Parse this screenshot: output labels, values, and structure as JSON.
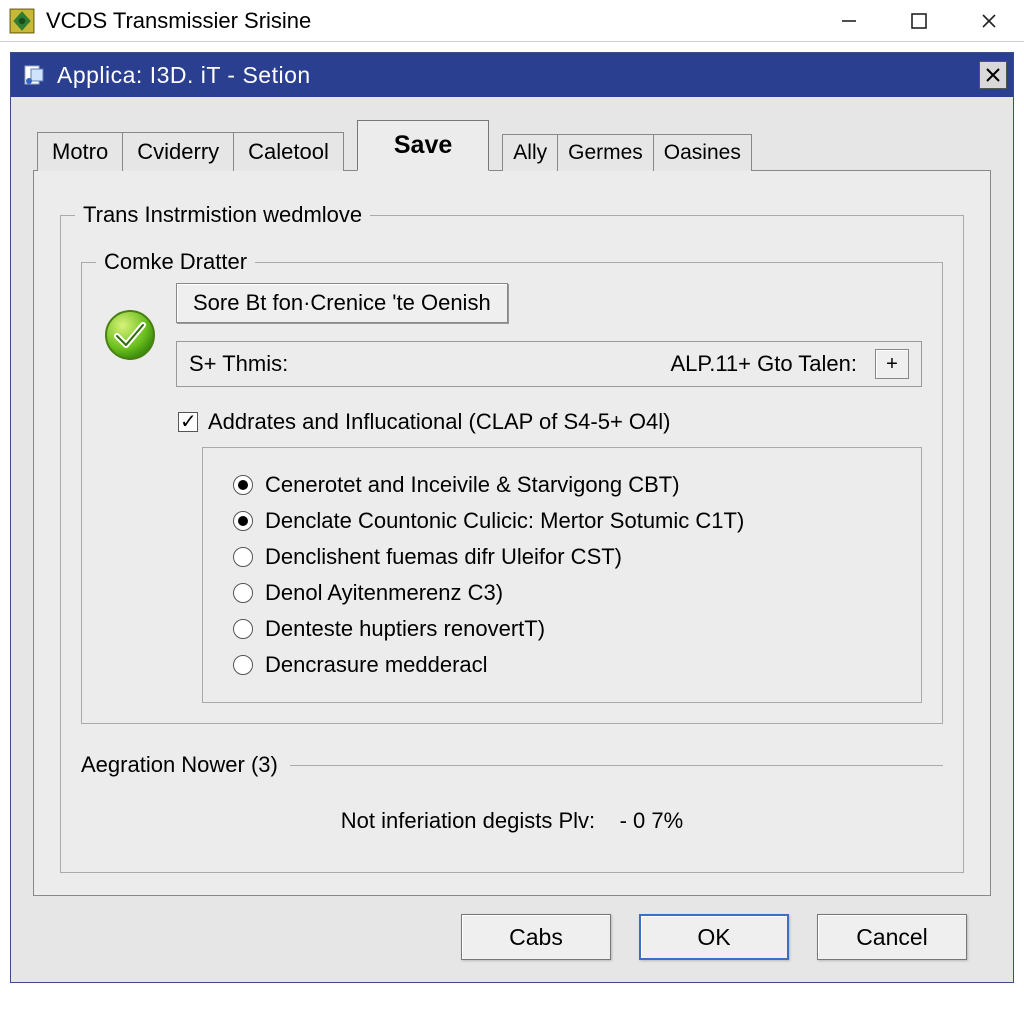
{
  "outer_window": {
    "title": "VCDS Transmissier Srisine"
  },
  "inner_window": {
    "title": "Applica: I3D. iT - Setion"
  },
  "tabs": [
    {
      "label": "Motro",
      "active": false
    },
    {
      "label": "Cviderry",
      "active": false
    },
    {
      "label": "Caletool",
      "active": false
    },
    {
      "label": "Save",
      "active": true
    },
    {
      "label": "Ally",
      "active": false
    },
    {
      "label": "Germes",
      "active": false
    },
    {
      "label": "Oasines",
      "active": false
    }
  ],
  "panel": {
    "heading": "Trans Instrmistion wedmlove",
    "group1": {
      "legend": "Comke Dratter",
      "button_label": "Sore Bt fon·Crenice 'te Oenish",
      "field_label": "S+ Thmis:",
      "field_value": "ALP.11+ Gto Talen:",
      "checkbox_label": "Addrates and Influcational (CLAP of S4-5+ O4l)",
      "checkbox_checked": true,
      "radios": [
        {
          "label": "Cenerotet and Inceivile & Starvigong CBT)",
          "checked": true
        },
        {
          "label": "Denclate Countonic Culicic: Mertor Sotumic C1T)",
          "checked": true
        },
        {
          "label": "Denclishent fuemas difr Uleifor CST)",
          "checked": false
        },
        {
          "label": "Denol Ayitenmerenz C3)",
          "checked": false
        },
        {
          "label": "Denteste huptiers renovertT)",
          "checked": false
        },
        {
          "label": "Dencrasure medderacl",
          "checked": false
        }
      ]
    },
    "group2": {
      "legend": "Aegration Nower (3)",
      "info_label": "Not inferiation degists Plv:",
      "info_value": "-   0 7%"
    }
  },
  "buttons": {
    "help": "Cabs",
    "ok": "OK",
    "cancel": "Cancel"
  }
}
